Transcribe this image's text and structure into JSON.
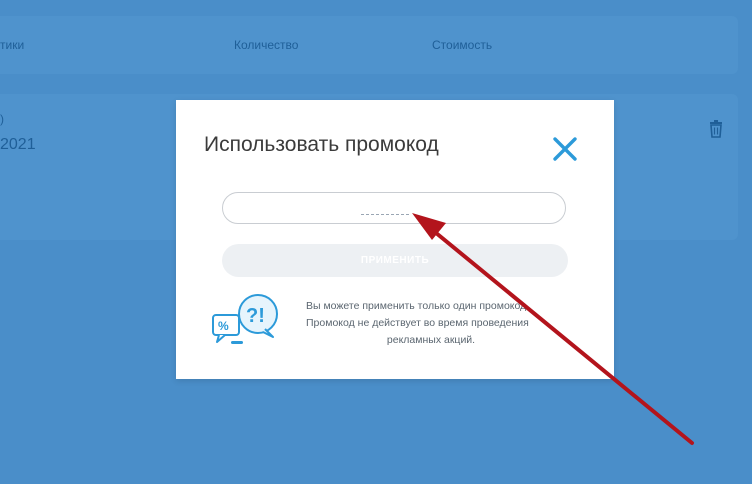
{
  "background": {
    "columns": [
      "тики",
      "Количество",
      "Стоимость"
    ],
    "row_note": ")",
    "row_year": "2021"
  },
  "modal": {
    "title": "Использовать промокод",
    "input": {
      "value": "",
      "placeholder": ""
    },
    "apply_label": "ПРИМЕНИТЬ",
    "info_lines": [
      "Вы можете применить только один промокод.",
      "Промокод не действует во время проведения",
      "рекламных акций."
    ],
    "icon_text": "?!",
    "icon_percent": "%"
  },
  "colors": {
    "accent": "#2c9ad9",
    "overlay": "#4a8ec9",
    "annotation_arrow": "#b3141c"
  }
}
